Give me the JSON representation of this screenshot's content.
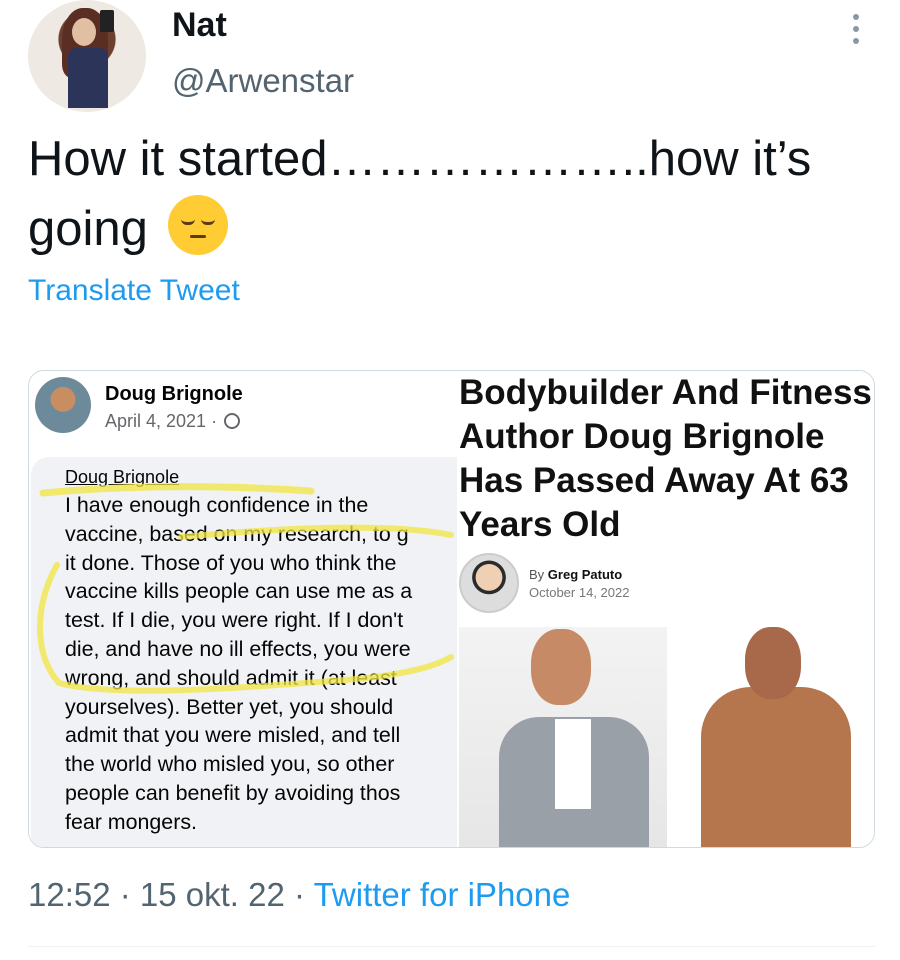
{
  "user": {
    "name": "Nat",
    "handle": "@Arwenstar"
  },
  "tweet": {
    "text": "How it started………………..how it’s going",
    "emoji": "pensive-face",
    "translate_label": "Translate Tweet"
  },
  "fb_post": {
    "author": "Doug Brignole",
    "date": "April 4, 2021 ·",
    "comment_name": "Doug Brignole",
    "comment_lines": [
      "I have enough confidence in the",
      "vaccine, based on my research, to g",
      "it done. Those of you who think the",
      "vaccine kills people can use me as a",
      "test. If I die, you were right. If I don't",
      "die, and have no ill effects, you were",
      "wrong, and should admit it (at least",
      "yourselves). Better yet, you should",
      "admit that you were misled, and tell",
      "the world who misled you, so other",
      "people can benefit by avoiding thos",
      "fear mongers."
    ]
  },
  "article": {
    "headline": "Bodybuilder And Fitness Author Doug Brignole Has Passed Away At 63 Years Old",
    "by": "By",
    "author": "Greg Patuto",
    "date": "October 14, 2022"
  },
  "meta": {
    "time_date": "12:52 · 15 okt. 22 · ",
    "client": "Twitter for iPhone"
  },
  "colors": {
    "link": "#1d9bf0",
    "secondary_text": "#536471",
    "highlighter": "#f2e640"
  }
}
